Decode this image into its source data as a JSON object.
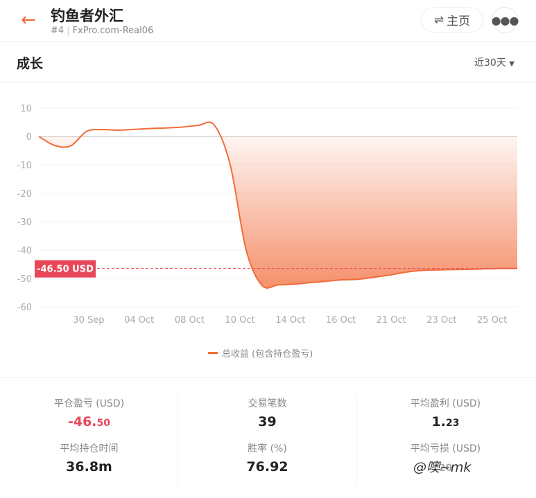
{
  "header": {
    "title": "钓鱼者外汇",
    "rank": "#4",
    "account": "FxPro.com-Real06",
    "home_label": "主页",
    "back_icon": "arrow-left-icon",
    "more_icon": "more-icon",
    "swap_icon": "swap-icon"
  },
  "section": {
    "title": "成长",
    "range": "近30天"
  },
  "colors": {
    "accent": "#f26b3a",
    "negative": "#e8475a"
  },
  "chart_data": {
    "type": "area",
    "y_ticks": [
      10,
      0,
      -10,
      -20,
      -30,
      -40,
      -50,
      -60
    ],
    "ylim": [
      -60,
      10
    ],
    "x_ticks": [
      "30 Sep",
      "04 Oct",
      "08 Oct",
      "10 Oct",
      "14 Oct",
      "16 Oct",
      "21 Oct",
      "23 Oct",
      "25 Oct"
    ],
    "series": [
      {
        "name": "总收益 (包含持仓盈亏)",
        "values": [
          0,
          -3.2,
          -3.3,
          1.8,
          2.4,
          2.2,
          2.5,
          2.8,
          3,
          3.3,
          3.9,
          4,
          -10,
          -40,
          -52.5,
          -52.3,
          -52,
          -51.5,
          -51,
          -50.5,
          -50.3,
          -49.6,
          -48.8,
          -47.8,
          -47.2,
          -47,
          -46.9,
          -46.8,
          -46.6,
          -46.5,
          -46.5
        ]
      }
    ],
    "current_label": "-46.50 USD",
    "current_value": -46.5,
    "grid": true,
    "legend_position": "bottom"
  },
  "stats": [
    {
      "label": "平仓盈亏 (USD)",
      "int": "-46.",
      "dec": "50",
      "negative": true
    },
    {
      "label": "交易笔数",
      "int": "39",
      "dec": ""
    },
    {
      "label": "平均盈利 (USD)",
      "int": "1.",
      "dec": "23"
    },
    {
      "label": "平均持仓时间",
      "int": "36.8m",
      "dec": ""
    },
    {
      "label": "胜率 (%)",
      "int": "76.92",
      "dec": ""
    },
    {
      "label": "平均亏损 (USD)",
      "int": "",
      "dec": "20"
    }
  ],
  "watermark": "@噢~mk"
}
